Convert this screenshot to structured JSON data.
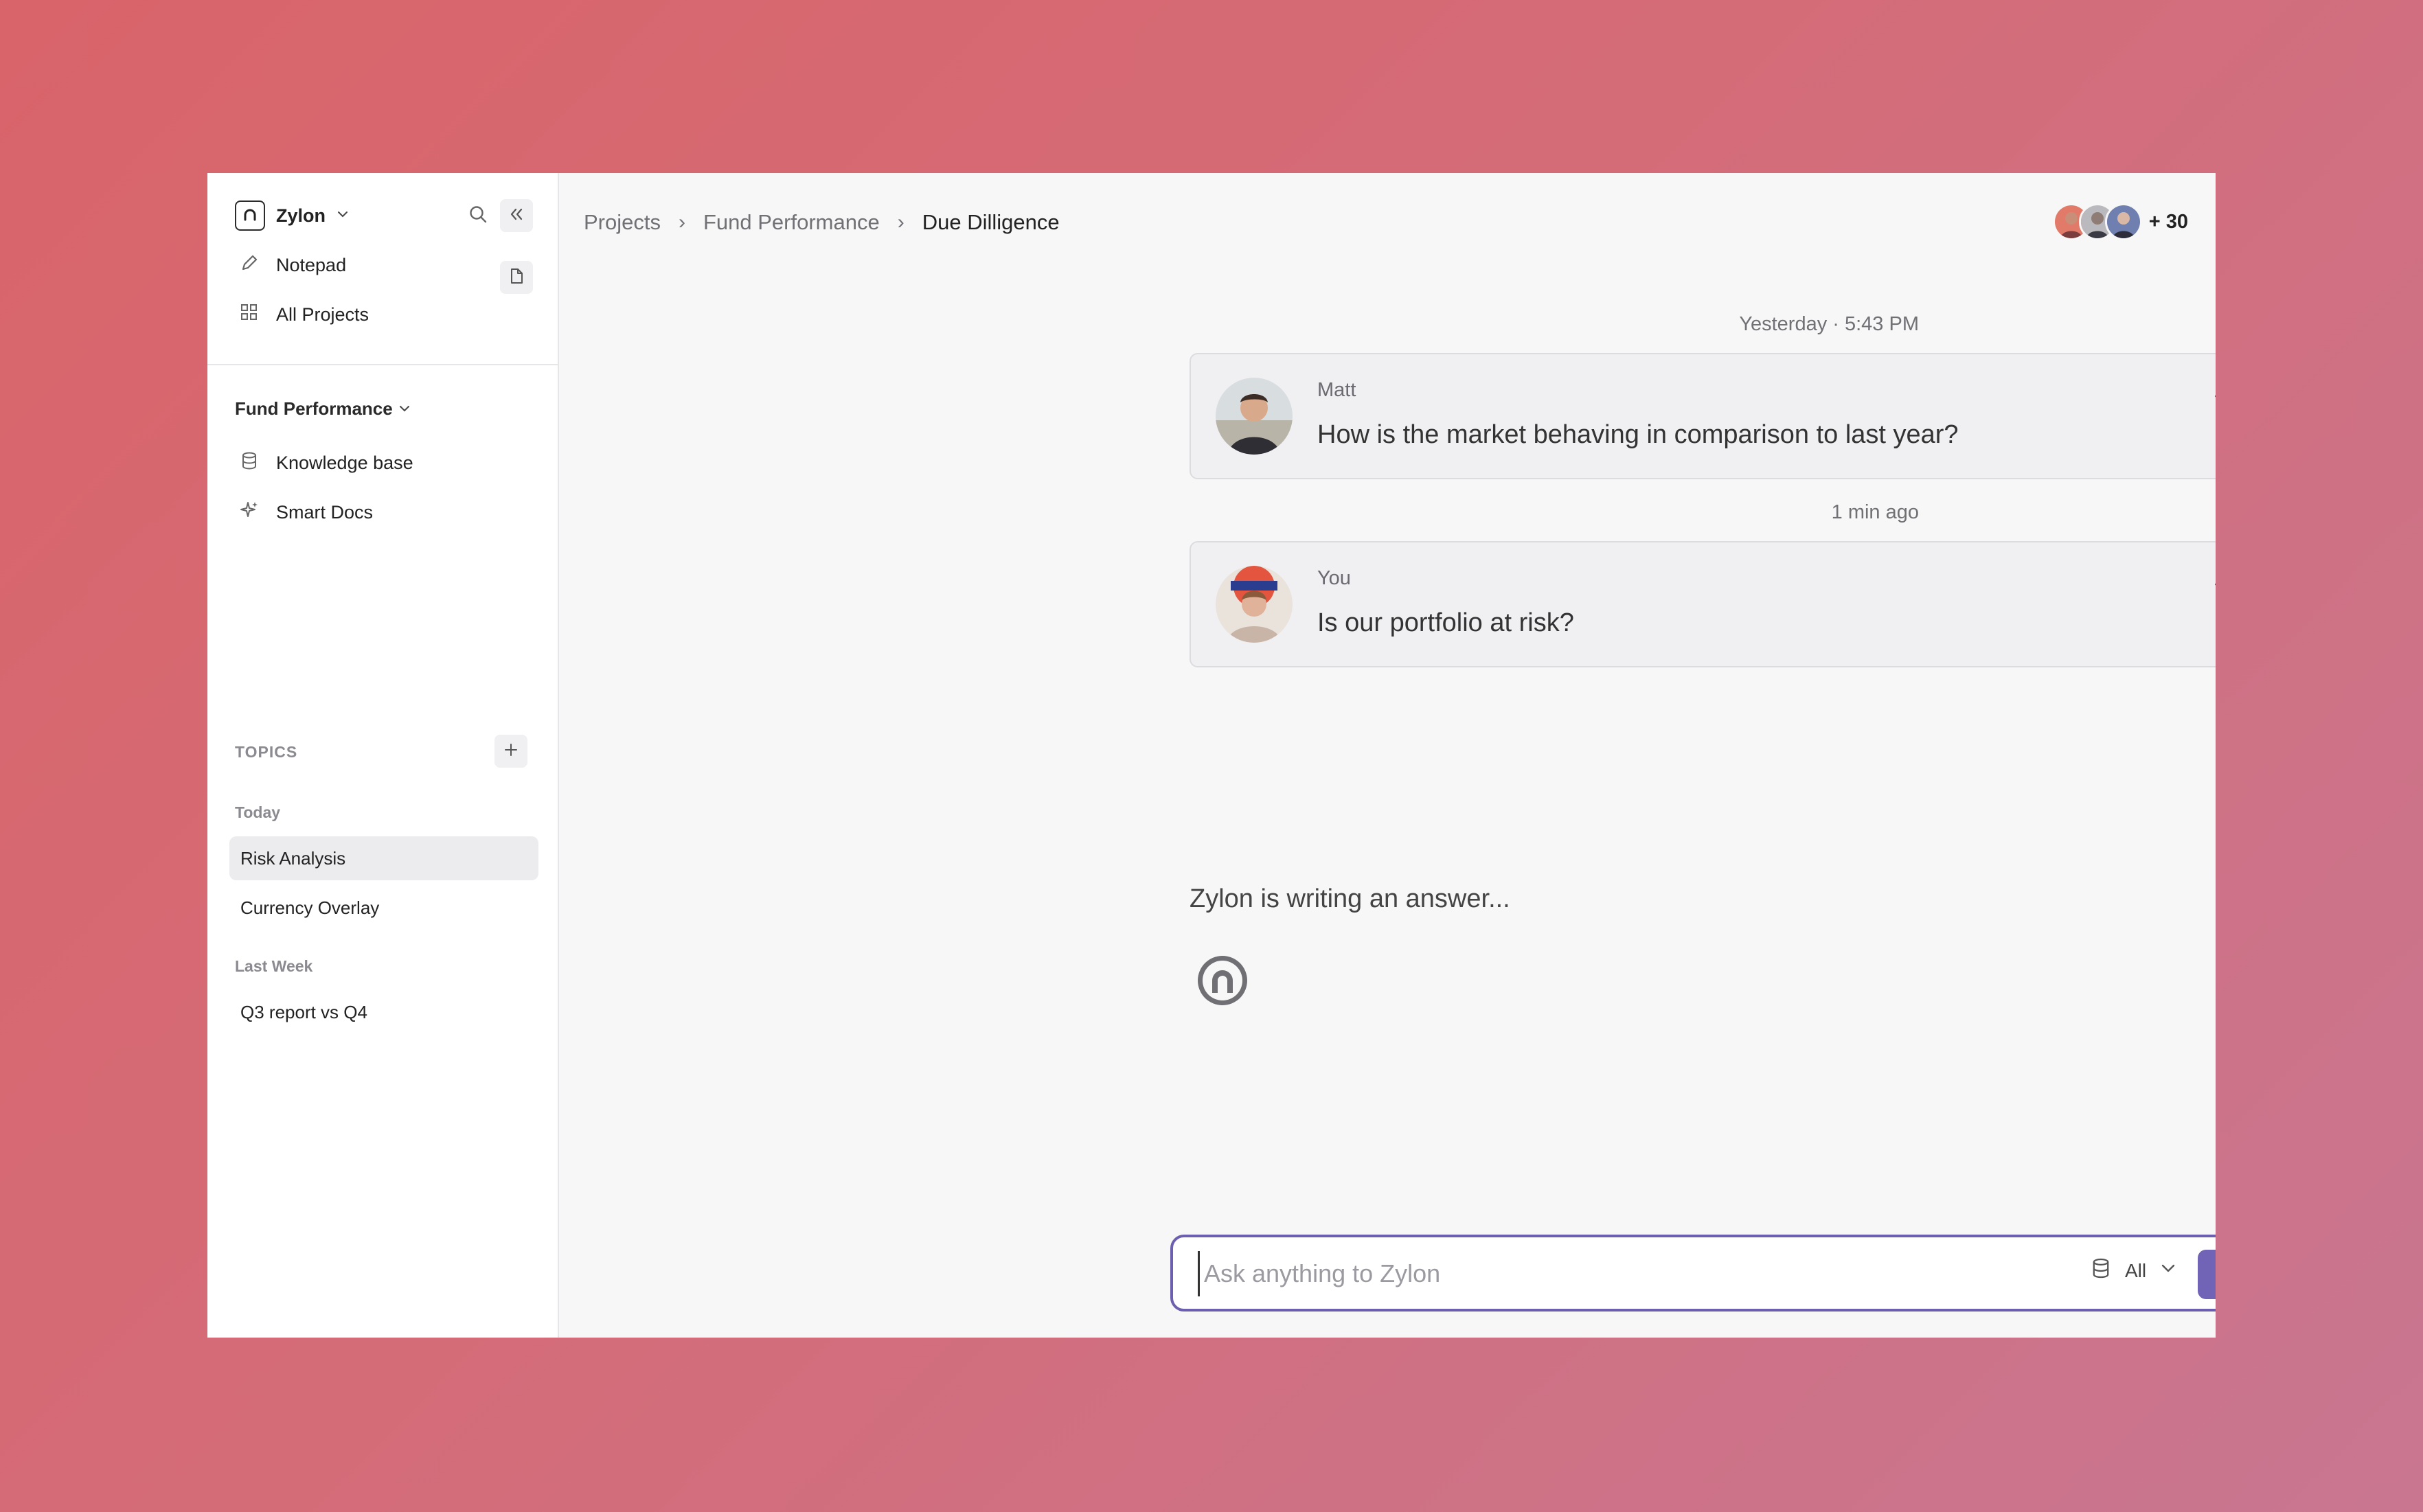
{
  "sidebar": {
    "workspace": {
      "name": "Zylon",
      "logo_icon": "zylon-logo-icon"
    },
    "nav": [
      {
        "label": "Notepad",
        "icon": "pencil-icon"
      },
      {
        "label": "All Projects",
        "icon": "grid-icon"
      }
    ],
    "project": {
      "name": "Fund Performance",
      "items": [
        {
          "label": "Knowledge base",
          "icon": "database-icon"
        },
        {
          "label": "Smart Docs",
          "icon": "sparkle-icon"
        }
      ]
    },
    "topics": {
      "label": "TOPICS",
      "groups": [
        {
          "label": "Today",
          "items": [
            "Risk Analysis",
            "Currency Overlay"
          ]
        },
        {
          "label": "Last Week",
          "items": [
            "Q3 report vs Q4"
          ]
        }
      ],
      "active": "Risk Analysis"
    }
  },
  "header": {
    "breadcrumb": [
      "Projects",
      "Fund Performance",
      "Due Dilligence"
    ],
    "separator": "›",
    "participants_extra": "+ 30"
  },
  "conversation": {
    "messages": [
      {
        "timestamp": "Yesterday · 5:43 PM",
        "author": "Matt",
        "text": "How is the market behaving in comparison to last year?"
      },
      {
        "timestamp": "1 min ago",
        "author": "You",
        "text": "Is our portfolio at risk?"
      }
    ],
    "status": "Zylon is writing an answer..."
  },
  "composer": {
    "placeholder": "Ask anything to Zylon",
    "source_label": "All"
  },
  "colors": {
    "accent": "#6c5fb0",
    "send_button": "#7163b5"
  }
}
